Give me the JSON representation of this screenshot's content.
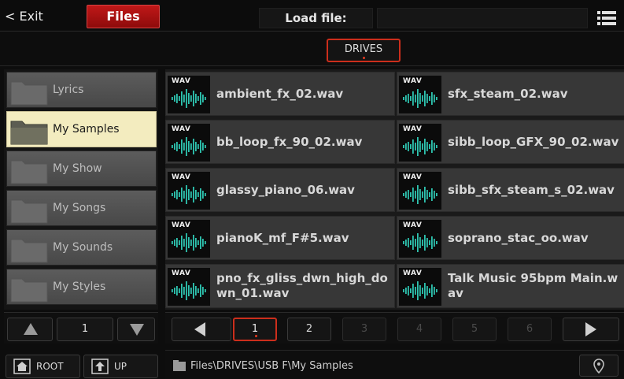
{
  "topbar": {
    "exit_label": "< Exit",
    "files_label": "Files",
    "load_label": "Load file:",
    "load_value": ""
  },
  "drives": {
    "label": "DRIVES"
  },
  "folders": [
    {
      "label": "Lyrics",
      "selected": false
    },
    {
      "label": "My Samples",
      "selected": true
    },
    {
      "label": "My Show",
      "selected": false
    },
    {
      "label": "My Songs",
      "selected": false
    },
    {
      "label": "My Sounds",
      "selected": false
    },
    {
      "label": "My Styles",
      "selected": false
    }
  ],
  "left_pager": {
    "page": "1"
  },
  "bottom_left": {
    "root_label": "ROOT",
    "up_label": "UP"
  },
  "files": [
    {
      "tag": "WAV",
      "name": "ambient_fx_02.wav"
    },
    {
      "tag": "WAV",
      "name": "sfx_steam_02.wav"
    },
    {
      "tag": "WAV",
      "name": "bb_loop_fx_90_02.wav"
    },
    {
      "tag": "WAV",
      "name": "sibb_loop_GFX_90_02.wav"
    },
    {
      "tag": "WAV",
      "name": "glassy_piano_06.wav"
    },
    {
      "tag": "WAV",
      "name": "sibb_sfx_steam_s_02.wav"
    },
    {
      "tag": "WAV",
      "name": "pianoK_mf_F#5.wav"
    },
    {
      "tag": "WAV",
      "name": "soprano_stac_oo.wav"
    },
    {
      "tag": "WAV",
      "name": "pno_fx_gliss_dwn_high_down_01.wav"
    },
    {
      "tag": "WAV",
      "name": "Talk Music 95bpm Main.wav"
    }
  ],
  "pages": [
    "1",
    "2",
    "3",
    "4",
    "5",
    "6"
  ],
  "status": {
    "path": "Files\\DRIVES\\USB F\\My Samples"
  },
  "colors": {
    "accent_red": "#cc2e1c",
    "wave_teal": "#2ec4b0",
    "selected_folder": "#f3ecbf"
  }
}
